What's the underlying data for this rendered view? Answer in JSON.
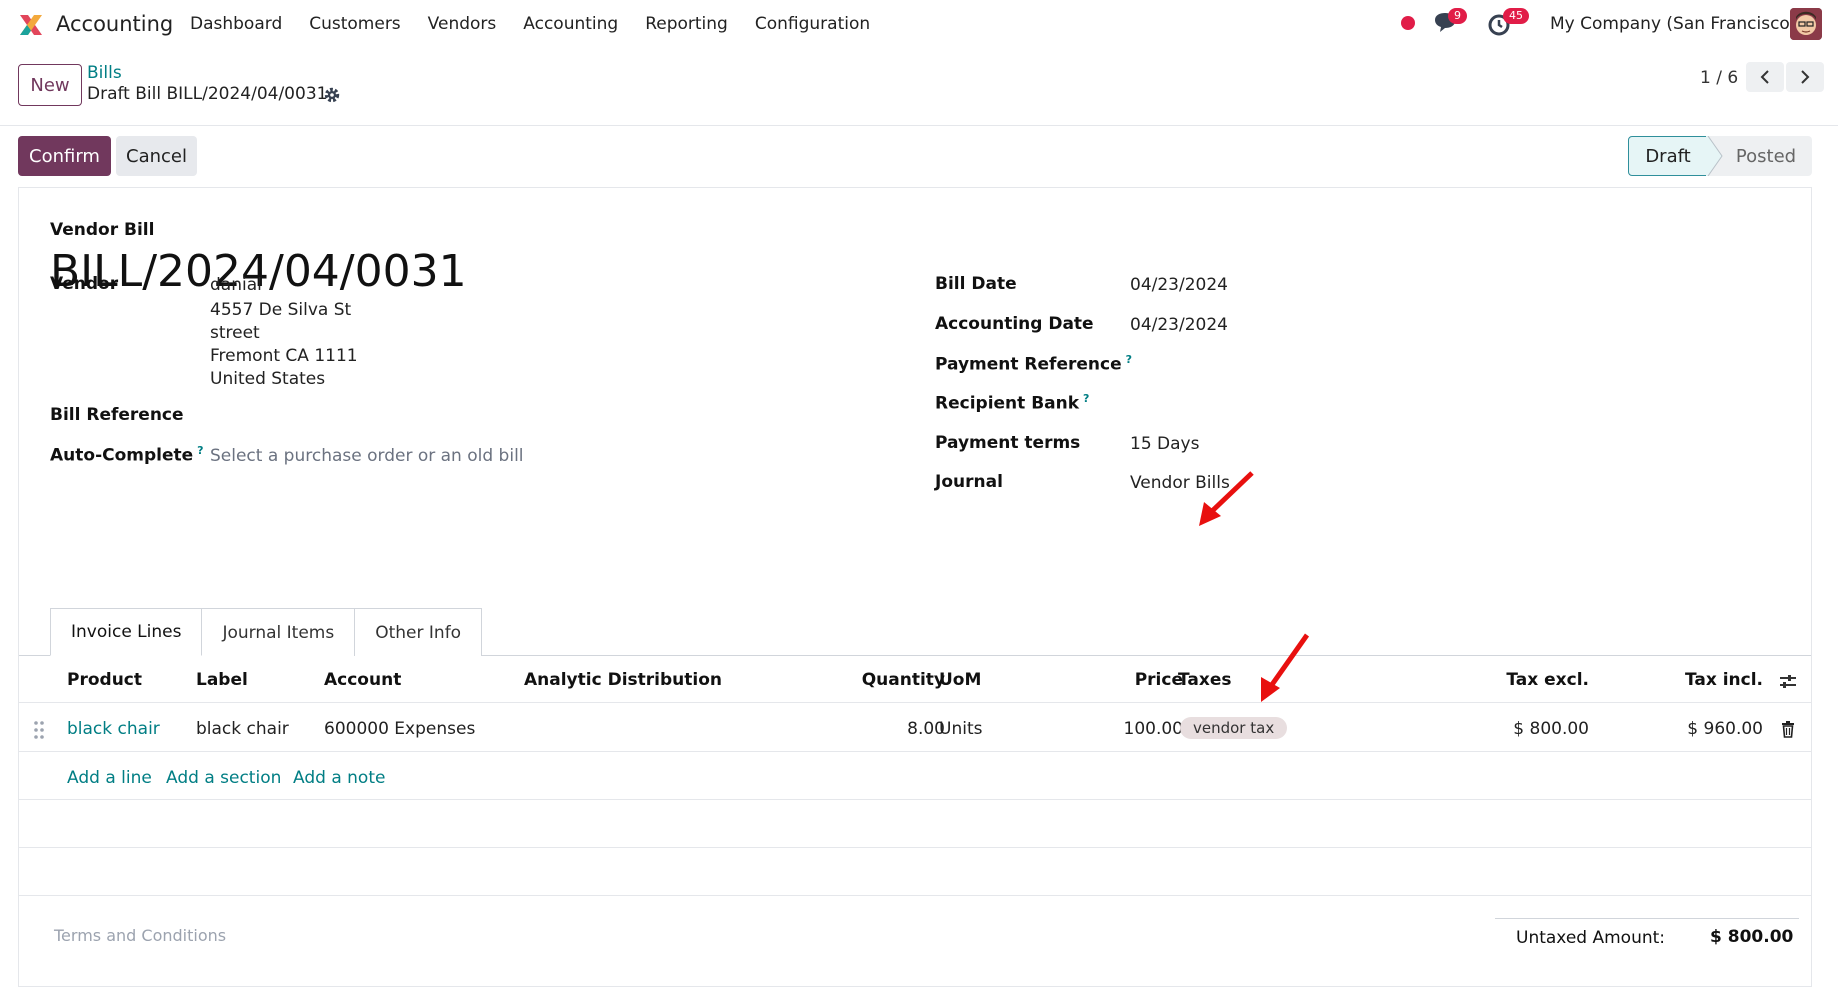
{
  "app": {
    "name": "Accounting"
  },
  "menu": [
    "Dashboard",
    "Customers",
    "Vendors",
    "Accounting",
    "Reporting",
    "Configuration"
  ],
  "systray": {
    "messages_count": "9",
    "activities_count": "45",
    "company": "My Company (San Francisco)"
  },
  "breadcrumb": {
    "parent": "Bills",
    "current": "Draft Bill BILL/2024/04/0031"
  },
  "toolbar": {
    "new_label": "New",
    "pager": "1 / 6"
  },
  "actions": {
    "confirm_label": "Confirm",
    "cancel_label": "Cancel"
  },
  "statusbar": {
    "draft": "Draft",
    "posted": "Posted"
  },
  "document": {
    "type": "Vendor Bill",
    "name": "BILL/2024/04/0031",
    "vendor_label": "Vendor",
    "vendor_address": [
      "danial",
      "4557 De Silva St",
      "street",
      "Fremont CA 1111",
      "United States"
    ],
    "bill_reference_label": "Bill Reference",
    "autocomplete_label": "Auto-Complete",
    "autocomplete_placeholder": "Select a purchase order or an old bill",
    "bill_date_label": "Bill Date",
    "bill_date": "04/23/2024",
    "accounting_date_label": "Accounting Date",
    "accounting_date": "04/23/2024",
    "payment_reference_label": "Payment Reference",
    "recipient_bank_label": "Recipient Bank",
    "payment_terms_label": "Payment terms",
    "payment_terms": "15 Days",
    "journal_label": "Journal",
    "journal": "Vendor Bills",
    "help_mark": "?"
  },
  "tabs": [
    "Invoice Lines",
    "Journal Items",
    "Other Info"
  ],
  "lines": {
    "headers": [
      "Product",
      "Label",
      "Account",
      "Analytic Distribution",
      "Quantity",
      "UoM",
      "Price",
      "Taxes",
      "Tax excl.",
      "Tax incl."
    ],
    "rows": [
      {
        "product": "black chair",
        "label": "black chair",
        "account": "600000 Expenses",
        "analytic": "",
        "quantity": "8.00",
        "uom": "Units",
        "price": "100.00",
        "tax": "vendor tax",
        "tax_excl": "$ 800.00",
        "tax_incl": "$ 960.00"
      }
    ],
    "add_line": "Add a line",
    "add_section": "Add a section",
    "add_note": "Add a note"
  },
  "footer": {
    "terms_placeholder": "Terms and Conditions",
    "untaxed_label": "Untaxed Amount:",
    "untaxed_value": "$ 800.00"
  },
  "colors": {
    "primary": "#71385d",
    "link": "#017e84",
    "badge": "#e11d48",
    "annotation_arrow": "#e8100f"
  }
}
